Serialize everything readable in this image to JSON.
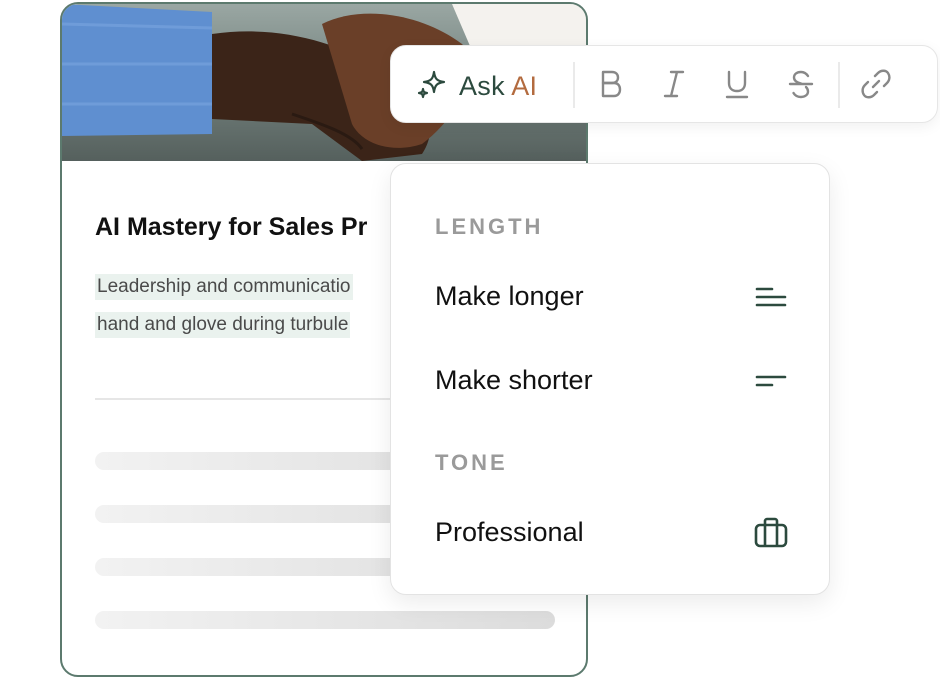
{
  "card": {
    "title": "AI Mastery for Sales Pr",
    "desc_lines": [
      "Leadership and communicatio",
      "hand and glove during turbule"
    ]
  },
  "toolbar": {
    "ask_prefix": "Ask ",
    "ask_ai": "AI",
    "buttons": [
      "bold-icon",
      "italic-icon",
      "underline-icon",
      "strikethrough-icon",
      "link-icon"
    ]
  },
  "menu": {
    "sections": [
      {
        "label": "LENGTH",
        "items": [
          {
            "label": "Make longer",
            "icon": "lines-long-icon"
          },
          {
            "label": "Make shorter",
            "icon": "lines-short-icon"
          }
        ]
      },
      {
        "label": "TONE",
        "items": [
          {
            "label": "Professional",
            "icon": "briefcase-icon"
          }
        ]
      }
    ]
  },
  "colors": {
    "accent": "#2c4a3e",
    "ai_orange": "#b36b3f",
    "card_border": "#5c7a6e",
    "highlight": "#eaf2ee"
  }
}
